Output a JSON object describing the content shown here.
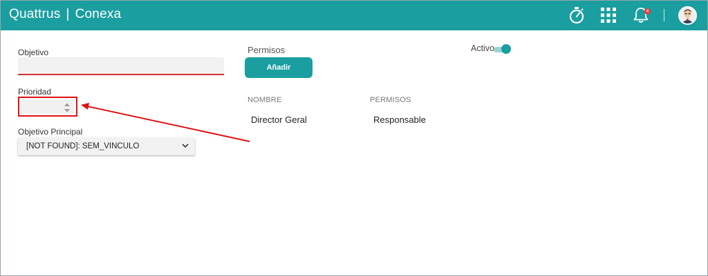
{
  "header": {
    "brand_left": "Quattrus",
    "brand_sep": "|",
    "brand_right": "Conexa",
    "notification_count": "4",
    "icons": [
      "stopwatch-icon",
      "apps-grid-icon",
      "bell-icon",
      "avatar"
    ]
  },
  "form": {
    "objetivo_label": "Objetivo",
    "objetivo_value": "",
    "prioridad_label": "Prioridad",
    "prioridad_value": "",
    "principal_label": "Objetivo Principal",
    "principal_value": "[NOT FOUND]: SEM_VINCULO"
  },
  "permisos": {
    "title": "Permisos",
    "add_label": "Añadir",
    "columns": [
      "NOMBRE",
      "PERMISOS"
    ],
    "rows": [
      {
        "nombre": "Director Geral",
        "permisos": "Responsable"
      }
    ]
  },
  "activo": {
    "label": "Activo",
    "enabled": true
  },
  "colors": {
    "primary": "#1a9ea0",
    "error": "#d32f2f",
    "annotation": "#e01010"
  }
}
